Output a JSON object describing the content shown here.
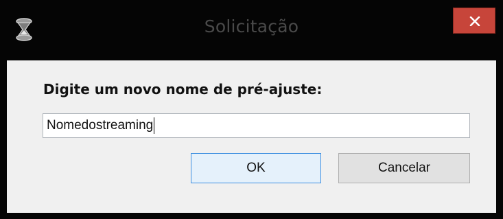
{
  "dialog": {
    "title": "Solicitação",
    "app_icon": "hourglass-icon",
    "close_icon": "close-icon",
    "prompt": "Digite um novo nome de pré-ajuste:",
    "input_value": "Nomedostreaming",
    "ok_label": "OK",
    "cancel_label": "Cancelar"
  },
  "colors": {
    "titlebar": "#050505",
    "close_button": "#c7453a",
    "client_background": "#f0f0f0",
    "ok_border": "#3c8ee0"
  }
}
